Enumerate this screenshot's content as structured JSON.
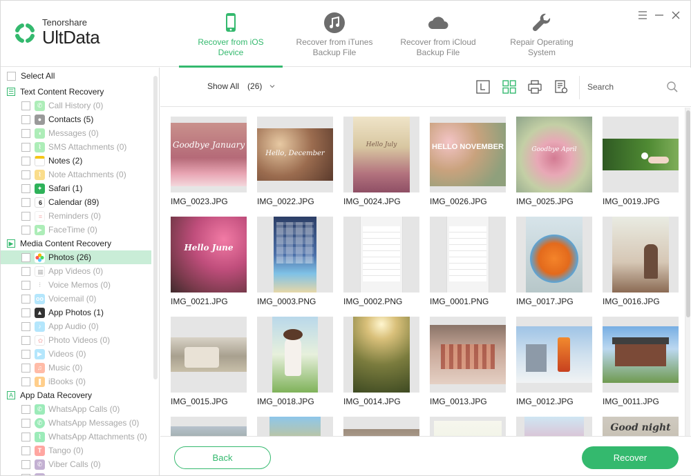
{
  "brand": {
    "small": "Tenorshare",
    "name": "UltData"
  },
  "tabs": [
    {
      "label": "Recover from iOS\nDevice",
      "active": true
    },
    {
      "label": "Recover from iTunes\nBackup File",
      "active": false
    },
    {
      "label": "Recover from iCloud\nBackup File",
      "active": false
    },
    {
      "label": "Repair Operating\nSystem",
      "active": false
    }
  ],
  "sidebar": {
    "select_all": "Select All",
    "text_category": "Text Content Recovery",
    "text_items": [
      "Call History (0)",
      "Contacts (5)",
      "Messages (0)",
      "SMS Attachments (0)",
      "Notes (2)",
      "Note Attachments (0)",
      "Safari (1)",
      "Calendar (89)",
      "Reminders (0)",
      "FaceTime (0)"
    ],
    "media_category": "Media Content Recovery",
    "media_items": [
      "Photos (26)",
      "App Videos (0)",
      "Voice Memos (0)",
      "Voicemail (0)",
      "App Photos (1)",
      "App Audio (0)",
      "Photo Videos (0)",
      "Videos (0)",
      "Music (0)",
      "iBooks (0)"
    ],
    "app_category": "App Data Recovery",
    "app_items": [
      "WhatsApp Calls (0)",
      "WhatsApp Messages (0)",
      "WhatsApp Attachments (0)",
      "Tango (0)",
      "Viber Calls (0)"
    ]
  },
  "toolbar": {
    "show_all": "Show All",
    "count": "(26)",
    "search_placeholder": "Search"
  },
  "photos": [
    "IMG_0023.JPG",
    "IMG_0022.JPG",
    "IMG_0024.JPG",
    "IMG_0026.JPG",
    "IMG_0025.JPG",
    "IMG_0019.JPG",
    "IMG_0021.JPG",
    "IMG_0003.PNG",
    "IMG_0002.PNG",
    "IMG_0001.PNG",
    "IMG_0017.JPG",
    "IMG_0016.JPG",
    "IMG_0015.JPG",
    "IMG_0018.JPG",
    "IMG_0014.JPG",
    "IMG_0013.JPG",
    "IMG_0012.JPG",
    "IMG_0011.JPG",
    "",
    "",
    "",
    "",
    "",
    ""
  ],
  "photo_overlays": {
    "p0": "Goodbye January",
    "p1": "Hello, December",
    "p2": "Hello July",
    "p3": "HELLO NOVEMBER",
    "p4": "Goodbye April",
    "p6": "Hello June",
    "p23": "Good night"
  },
  "buttons": {
    "back": "Back",
    "recover": "Recover"
  },
  "colors": {
    "accent": "#34b96e",
    "selected_row": "#c9edd7"
  }
}
